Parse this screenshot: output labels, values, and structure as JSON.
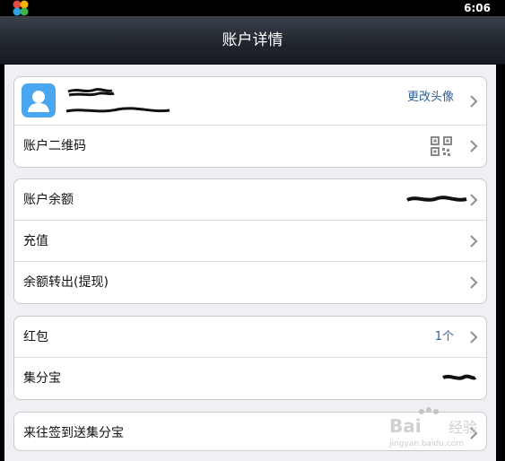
{
  "status_bar": {
    "time": "6:06"
  },
  "header": {
    "title": "账户详情"
  },
  "profile": {
    "change_avatar_label": "更改头像"
  },
  "group1": {
    "qr_label": "账户二维码"
  },
  "group2": {
    "balance_label": "账户余额",
    "recharge_label": "充值",
    "withdraw_label": "余额转出(提现)"
  },
  "group3": {
    "redpacket_label": "红包",
    "redpacket_count": "1个",
    "jifenbao_label": "集分宝"
  },
  "group4": {
    "signin_label": "来往签到送集分宝"
  },
  "watermark": {
    "brand": "Bai",
    "brand2": "经验",
    "url": "jingyan.baidu.com"
  },
  "colors": {
    "accent": "#2f5f96",
    "avatar_bg": "#4aa7ef",
    "titlebar": "#20252c"
  }
}
